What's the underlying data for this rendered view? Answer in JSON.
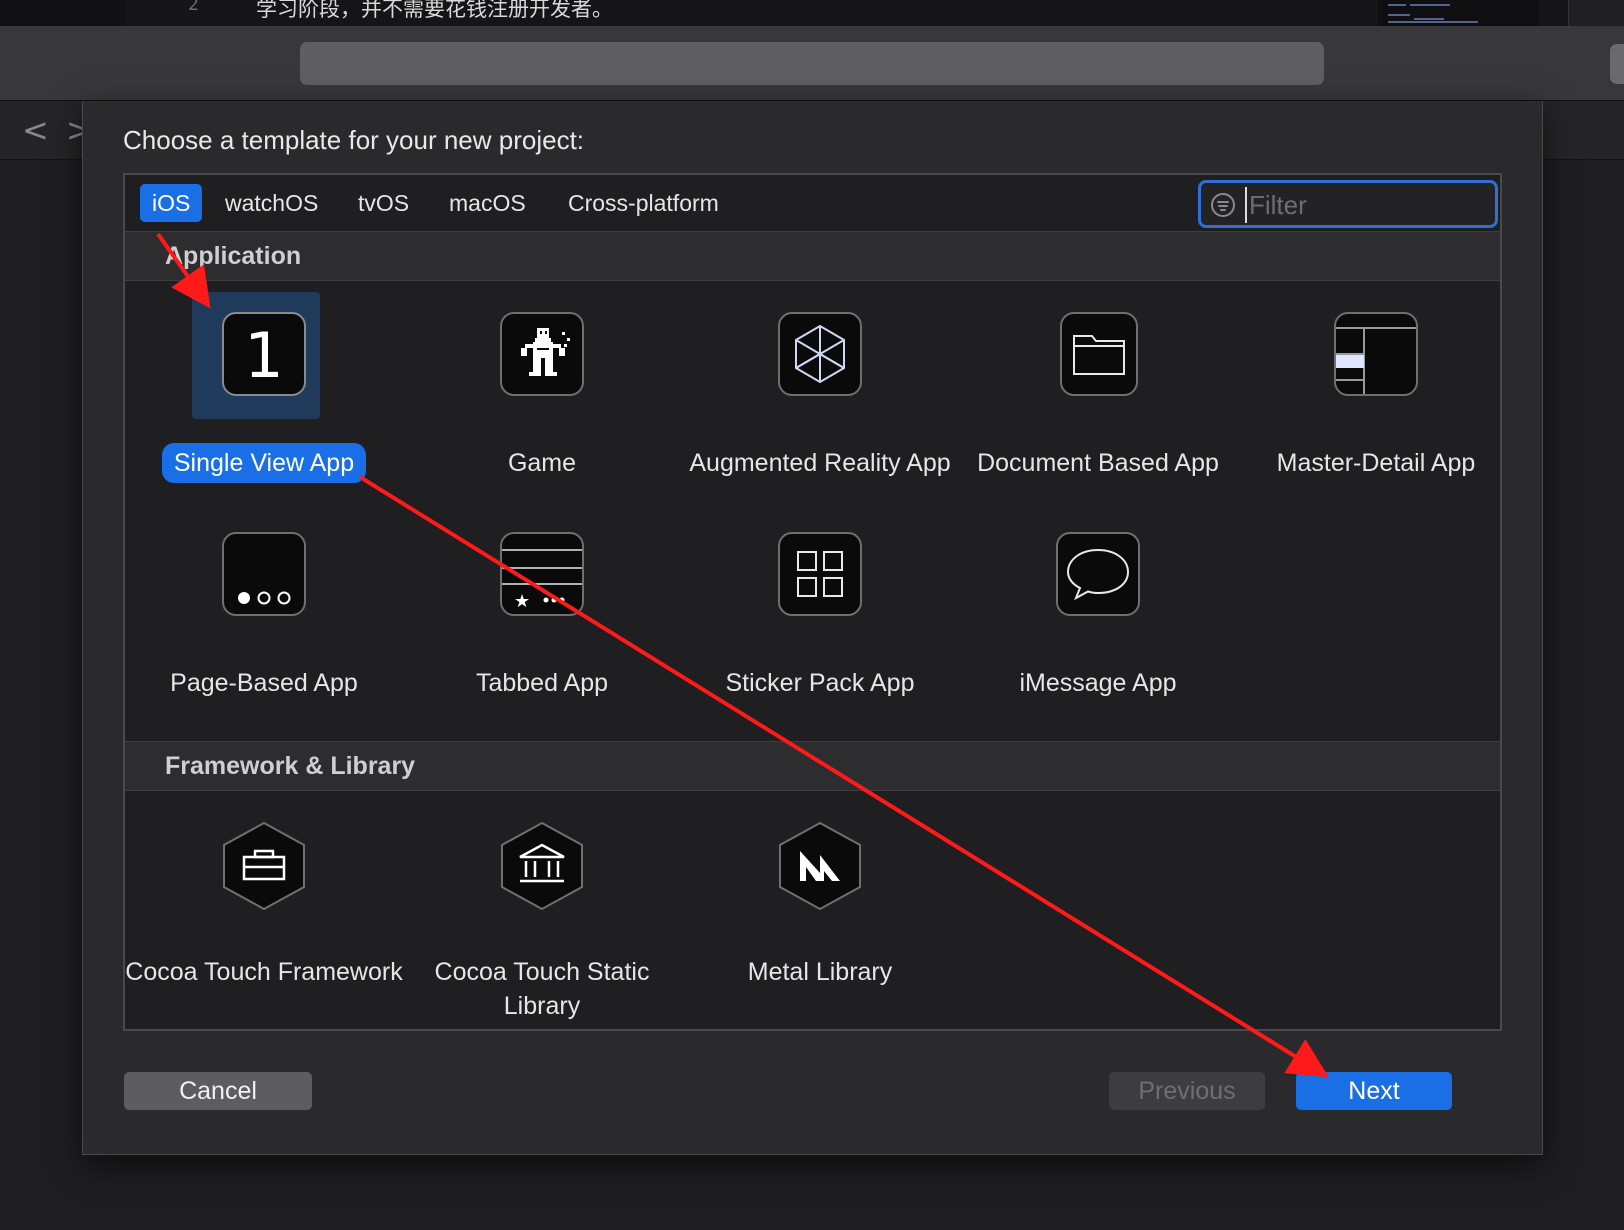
{
  "background": {
    "line_number": "2",
    "code_line": "学习阶段，并不需要花钱注册开发者。",
    "nav_back": "<",
    "nav_forward": ">"
  },
  "dialog": {
    "title": "Choose a template for your new project:",
    "tabs": [
      {
        "label": "iOS",
        "selected": true
      },
      {
        "label": "watchOS",
        "selected": false
      },
      {
        "label": "tvOS",
        "selected": false
      },
      {
        "label": "macOS",
        "selected": false
      },
      {
        "label": "Cross-platform",
        "selected": false
      }
    ],
    "filter": {
      "placeholder": "Filter",
      "value": ""
    },
    "sections": [
      {
        "title": "Application",
        "templates": [
          {
            "label": "Single View App",
            "icon": "single-view-icon",
            "glyph": "1",
            "selected": true
          },
          {
            "label": "Game",
            "icon": "game-icon",
            "selected": false
          },
          {
            "label": "Augmented Reality App",
            "icon": "ar-cube-icon",
            "selected": false
          },
          {
            "label": "Document Based App",
            "icon": "folder-icon",
            "selected": false
          },
          {
            "label": "Master-Detail App",
            "icon": "master-detail-icon",
            "selected": false
          },
          {
            "label": "Page-Based App",
            "icon": "page-dots-icon",
            "selected": false
          },
          {
            "label": "Tabbed App",
            "icon": "tab-bar-icon",
            "selected": false
          },
          {
            "label": "Sticker Pack App",
            "icon": "sticker-grid-icon",
            "selected": false
          },
          {
            "label": "iMessage App",
            "icon": "message-bubble-icon",
            "selected": false
          }
        ]
      },
      {
        "title": "Framework & Library",
        "templates": [
          {
            "label": "Cocoa Touch Framework",
            "icon": "toolbox-hex-icon",
            "selected": false
          },
          {
            "label": "Cocoa Touch Static Library",
            "icon": "bank-hex-icon",
            "selected": false
          },
          {
            "label": "Metal Library",
            "icon": "metal-hex-icon",
            "selected": false
          }
        ]
      }
    ],
    "buttons": {
      "cancel": "Cancel",
      "previous": "Previous",
      "next": "Next"
    }
  },
  "colors": {
    "accent": "#1a6ee6",
    "annotation": "#ff1a1a",
    "sheet": "#2a2a2c"
  }
}
